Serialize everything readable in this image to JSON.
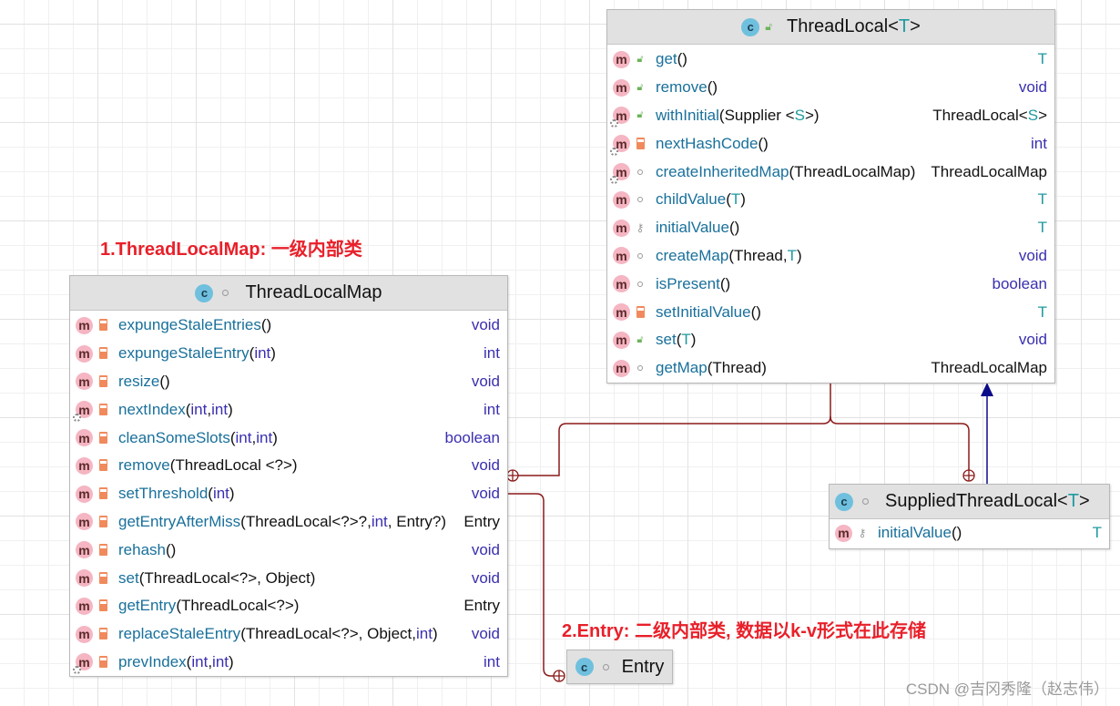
{
  "colors": {
    "connector": "#8b1a1a",
    "inherit": "#0b0b8a",
    "annotation": "#e8202a"
  },
  "annotations": {
    "first": "1.ThreadLocalMap: 一级内部类",
    "second": "2.Entry: 二级内部类, 数据以k-v形式在此存储"
  },
  "watermark": "CSDN @吉冈秀隆（赵志伟）",
  "threadLocal": {
    "title": "ThreadLocal",
    "generic": "T",
    "icon": "class-icon",
    "rows": [
      {
        "name": "get",
        "vis": "public",
        "static": false,
        "params": [
          [
            "()",
            "p"
          ]
        ],
        "ret": [
          [
            "T",
            "g"
          ]
        ]
      },
      {
        "name": "remove",
        "vis": "public",
        "static": false,
        "params": [
          [
            "()",
            "p"
          ]
        ],
        "ret": [
          [
            "void",
            "k"
          ]
        ]
      },
      {
        "name": "withInitial",
        "vis": "public",
        "static": true,
        "params": [
          [
            "(Supplier <",
            "p"
          ],
          [
            "S",
            "g"
          ],
          [
            ">)",
            "p"
          ]
        ],
        "ret": [
          [
            "ThreadLocal<",
            "p"
          ],
          [
            "S",
            "g"
          ],
          [
            ">",
            "p"
          ]
        ]
      },
      {
        "name": "nextHashCode",
        "vis": "private",
        "static": true,
        "params": [
          [
            "()",
            "p"
          ]
        ],
        "ret": [
          [
            "int",
            "k"
          ]
        ]
      },
      {
        "name": "createInheritedMap",
        "vis": "package",
        "static": true,
        "params": [
          [
            "(ThreadLocalMap)",
            "p"
          ]
        ],
        "ret": [
          [
            "ThreadLocalMap",
            "p"
          ]
        ]
      },
      {
        "name": "childValue",
        "vis": "package",
        "static": false,
        "params": [
          [
            "(",
            "p"
          ],
          [
            "T",
            "g"
          ],
          [
            ")",
            "p"
          ]
        ],
        "ret": [
          [
            "T",
            "g"
          ]
        ]
      },
      {
        "name": "initialValue",
        "vis": "protected",
        "static": false,
        "params": [
          [
            "()",
            "p"
          ]
        ],
        "ret": [
          [
            "T",
            "g"
          ]
        ]
      },
      {
        "name": "createMap",
        "vis": "package",
        "static": false,
        "params": [
          [
            "(Thread, ",
            "p"
          ],
          [
            "T",
            "g"
          ],
          [
            ")",
            "p"
          ]
        ],
        "ret": [
          [
            "void",
            "k"
          ]
        ]
      },
      {
        "name": "isPresent",
        "vis": "package",
        "static": false,
        "params": [
          [
            "()",
            "p"
          ]
        ],
        "ret": [
          [
            "boolean",
            "k"
          ]
        ]
      },
      {
        "name": "setInitialValue",
        "vis": "private",
        "static": false,
        "params": [
          [
            "()",
            "p"
          ]
        ],
        "ret": [
          [
            "T",
            "g"
          ]
        ]
      },
      {
        "name": "set",
        "vis": "public",
        "static": false,
        "params": [
          [
            "(",
            "p"
          ],
          [
            "T",
            "g"
          ],
          [
            ")",
            "p"
          ]
        ],
        "ret": [
          [
            "void",
            "k"
          ]
        ]
      },
      {
        "name": "getMap",
        "vis": "package",
        "static": false,
        "params": [
          [
            "(Thread)",
            "p"
          ]
        ],
        "ret": [
          [
            "ThreadLocalMap",
            "p"
          ]
        ]
      }
    ]
  },
  "threadLocalMap": {
    "title": "ThreadLocalMap",
    "rows": [
      {
        "name": "expungeStaleEntries",
        "vis": "private",
        "static": false,
        "params": [
          [
            "()",
            "p"
          ]
        ],
        "ret": [
          [
            "void",
            "k"
          ]
        ]
      },
      {
        "name": "expungeStaleEntry",
        "vis": "private",
        "static": false,
        "params": [
          [
            "(",
            "p"
          ],
          [
            "int",
            "k"
          ],
          [
            ")",
            "p"
          ]
        ],
        "ret": [
          [
            "int",
            "k"
          ]
        ]
      },
      {
        "name": "resize",
        "vis": "private",
        "static": false,
        "params": [
          [
            "()",
            "p"
          ]
        ],
        "ret": [
          [
            "void",
            "k"
          ]
        ]
      },
      {
        "name": "nextIndex",
        "vis": "private",
        "static": true,
        "params": [
          [
            "(",
            "p"
          ],
          [
            "int",
            "k"
          ],
          [
            ", ",
            "p"
          ],
          [
            "int",
            "k"
          ],
          [
            ")",
            "p"
          ]
        ],
        "ret": [
          [
            "int",
            "k"
          ]
        ]
      },
      {
        "name": "cleanSomeSlots",
        "vis": "private",
        "static": false,
        "params": [
          [
            "(",
            "p"
          ],
          [
            "int",
            "k"
          ],
          [
            ", ",
            "p"
          ],
          [
            "int",
            "k"
          ],
          [
            ")",
            "p"
          ]
        ],
        "ret": [
          [
            "boolean",
            "k"
          ]
        ]
      },
      {
        "name": "remove",
        "vis": "private",
        "static": false,
        "params": [
          [
            "(ThreadLocal <?>)",
            "p"
          ]
        ],
        "ret": [
          [
            "void",
            "k"
          ]
        ]
      },
      {
        "name": "setThreshold",
        "vis": "private",
        "static": false,
        "params": [
          [
            "(",
            "p"
          ],
          [
            "int",
            "k"
          ],
          [
            ")",
            "p"
          ]
        ],
        "ret": [
          [
            "void",
            "k"
          ]
        ]
      },
      {
        "name": "getEntryAfterMiss",
        "vis": "private",
        "static": false,
        "params": [
          [
            "(ThreadLocal<?>?, ",
            "p"
          ],
          [
            "int",
            "k"
          ],
          [
            ", Entry?)",
            "p"
          ]
        ],
        "ret": [
          [
            "Entry",
            "p"
          ]
        ]
      },
      {
        "name": "rehash",
        "vis": "private",
        "static": false,
        "params": [
          [
            "()",
            "p"
          ]
        ],
        "ret": [
          [
            "void",
            "k"
          ]
        ]
      },
      {
        "name": "set",
        "vis": "private",
        "static": false,
        "params": [
          [
            "(ThreadLocal<?>, Object)",
            "p"
          ]
        ],
        "ret": [
          [
            "void",
            "k"
          ]
        ]
      },
      {
        "name": "getEntry",
        "vis": "private",
        "static": false,
        "params": [
          [
            "(ThreadLocal<?>)",
            "p"
          ]
        ],
        "ret": [
          [
            "Entry",
            "p"
          ]
        ]
      },
      {
        "name": "replaceStaleEntry",
        "vis": "private",
        "static": false,
        "params": [
          [
            "(ThreadLocal<?>, Object, ",
            "p"
          ],
          [
            "int",
            "k"
          ],
          [
            ")",
            "p"
          ]
        ],
        "ret": [
          [
            "void",
            "k"
          ]
        ]
      },
      {
        "name": "prevIndex",
        "vis": "private",
        "static": true,
        "params": [
          [
            "(",
            "p"
          ],
          [
            "int",
            "k"
          ],
          [
            ", ",
            "p"
          ],
          [
            "int",
            "k"
          ],
          [
            ")",
            "p"
          ]
        ],
        "ret": [
          [
            "int",
            "k"
          ]
        ]
      }
    ]
  },
  "supplied": {
    "title": "SuppliedThreadLocal",
    "generic": "T",
    "rows": [
      {
        "name": "initialValue",
        "vis": "protected",
        "static": false,
        "params": [
          [
            "()",
            "p"
          ]
        ],
        "ret": [
          [
            "T",
            "g"
          ]
        ]
      }
    ]
  },
  "entry": {
    "title": "Entry"
  }
}
